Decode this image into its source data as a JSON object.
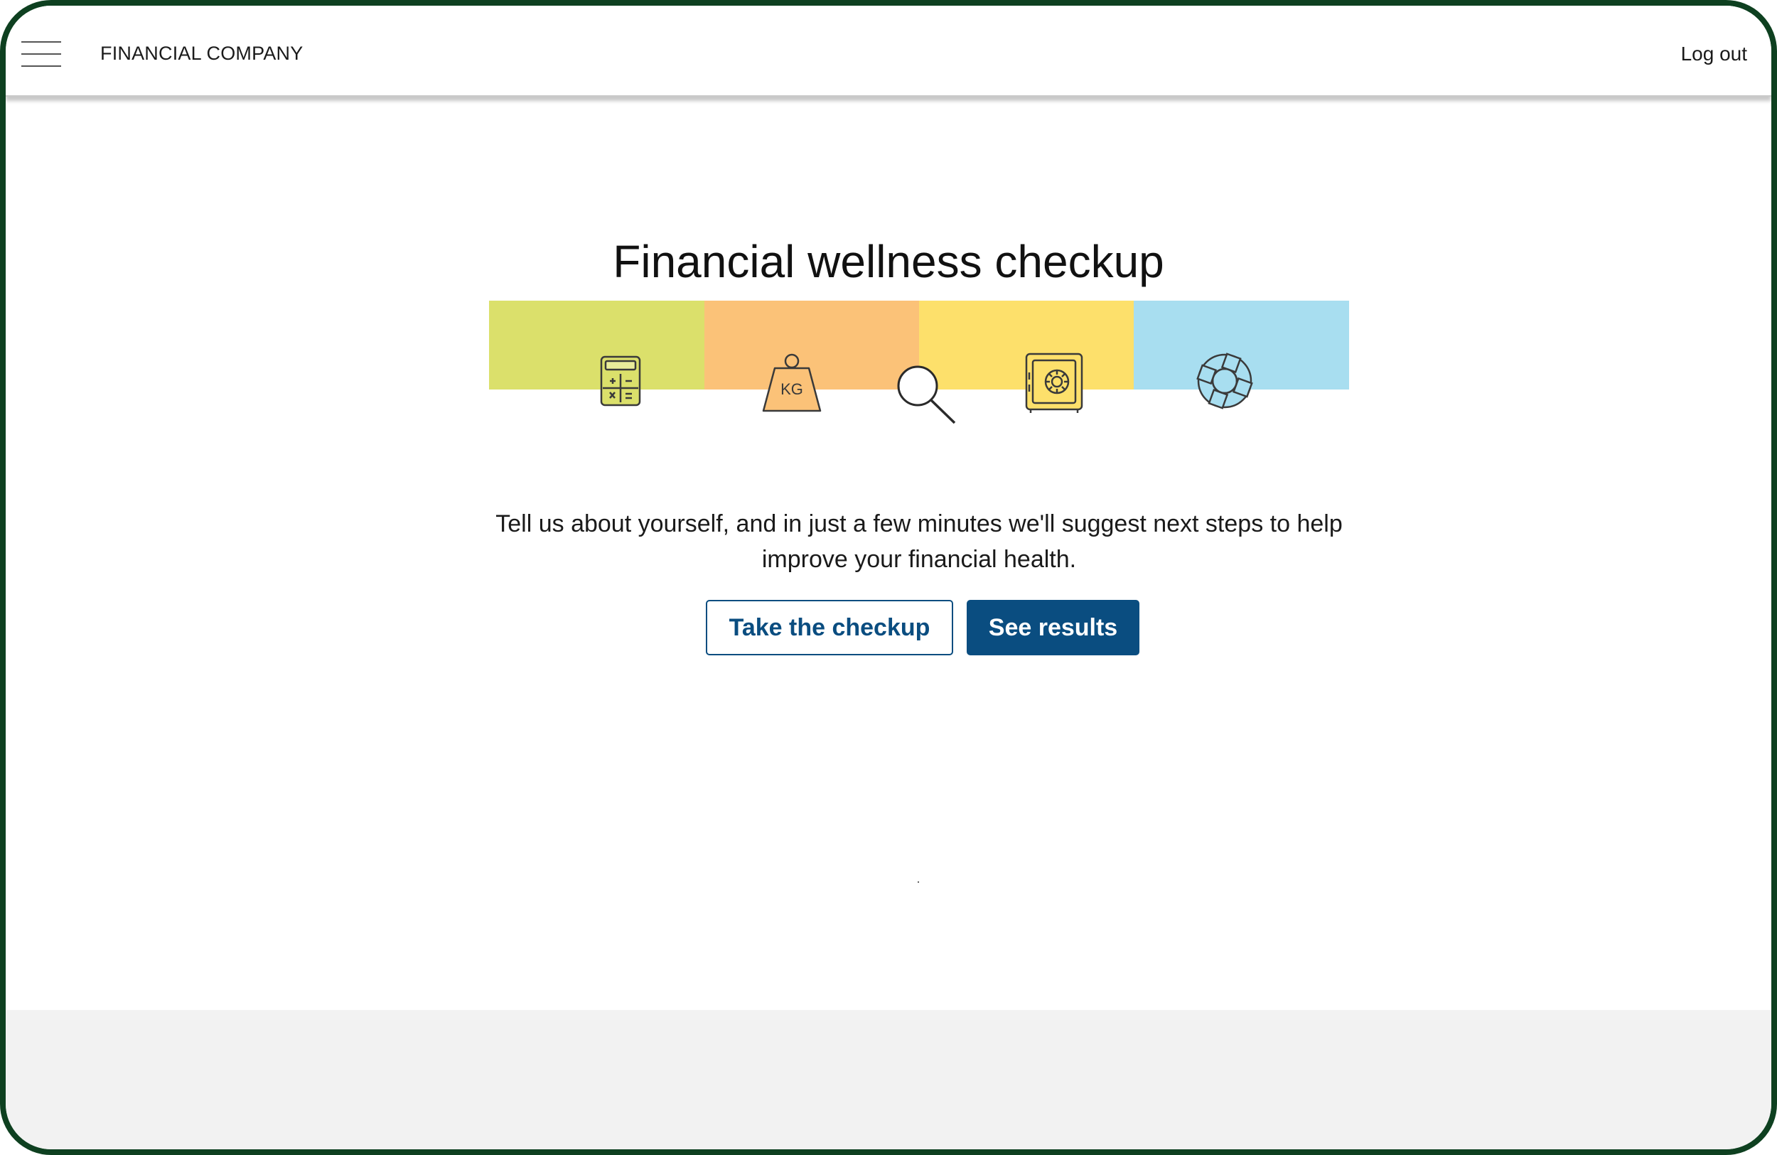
{
  "header": {
    "brand": "FINANCIAL COMPANY",
    "menu_icon": "hamburger-menu-icon",
    "logout_label": "Log out"
  },
  "main": {
    "title": "Financial wellness checkup",
    "banner": {
      "colors": [
        "#dbe06b",
        "#fbc278",
        "#fde06b",
        "#a8def0"
      ],
      "icons": [
        "calculator-icon",
        "kg-weight-icon",
        "magnifying-glass-icon",
        "safe-icon",
        "life-preserver-icon"
      ],
      "weight_label": "KG"
    },
    "intro_line1": "Tell us about yourself, and in just a few minutes we'll suggest next steps to help",
    "intro_line2": "improve your financial health.",
    "primary_button": "Take the checkup",
    "secondary_button": "See results"
  },
  "colors": {
    "accent": "#0a4d80",
    "device_frame": "#0e4020",
    "footer": "#f2f2f2"
  }
}
